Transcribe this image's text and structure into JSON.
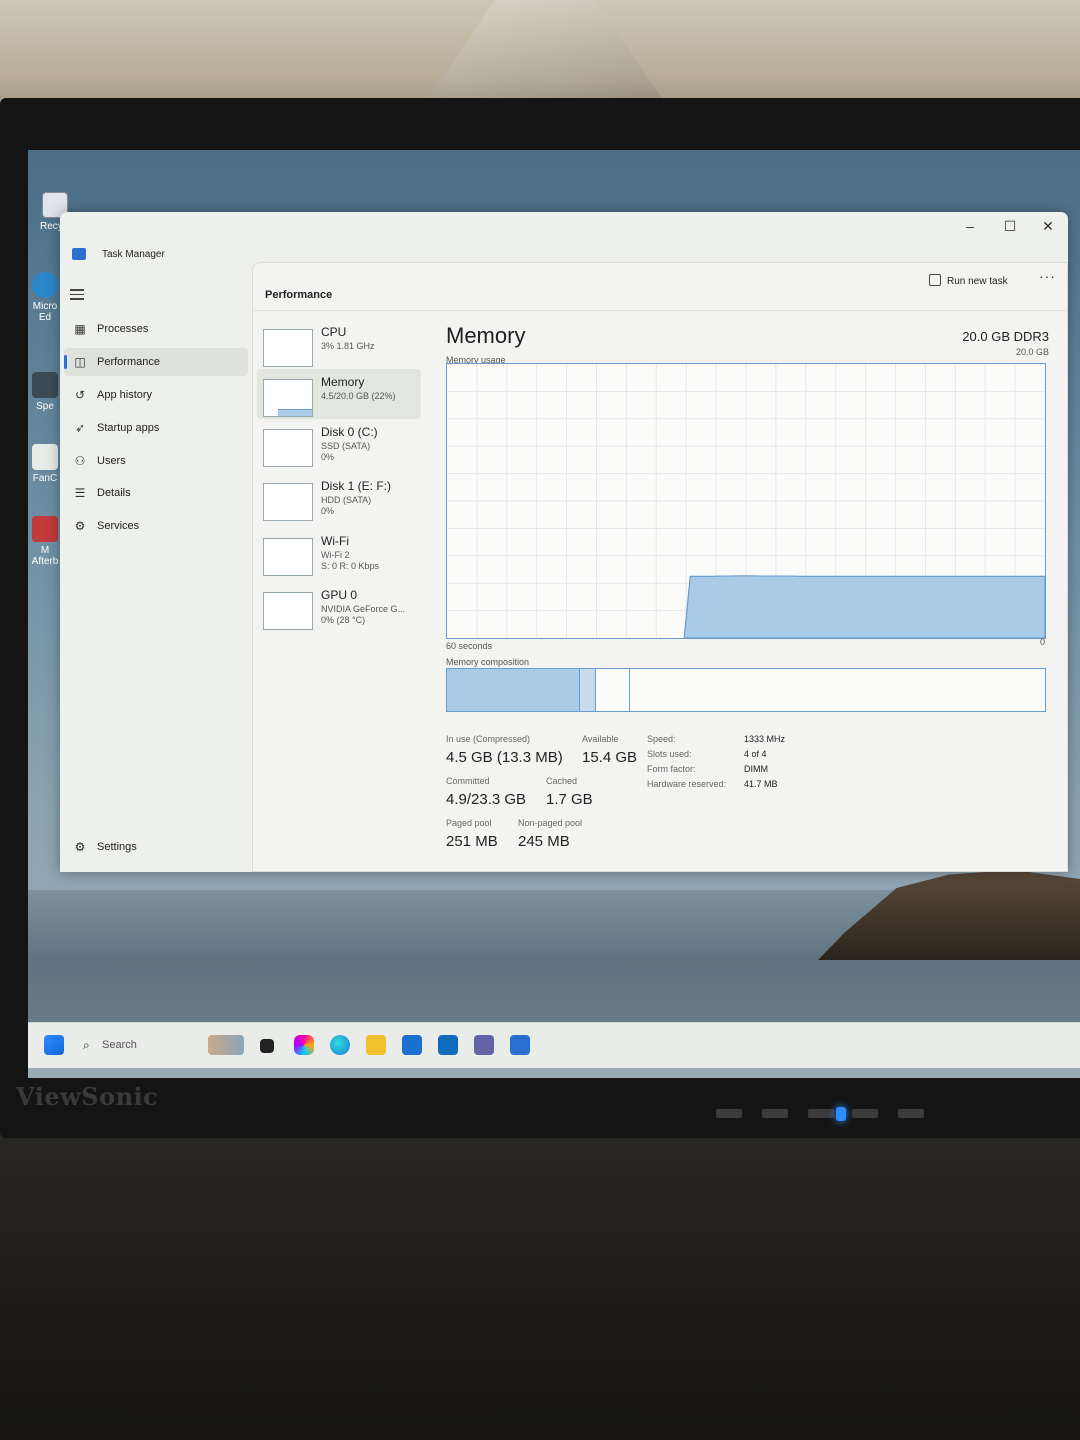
{
  "window": {
    "title": "Task Manager",
    "minimize": "–",
    "maximize": "☐",
    "close": "✕"
  },
  "header": {
    "section": "Performance",
    "run_new_task": "Run new task",
    "more": "···"
  },
  "nav": [
    {
      "label": "Processes",
      "icon": "grid-icon"
    },
    {
      "label": "Performance",
      "icon": "chart-icon",
      "active": true
    },
    {
      "label": "App history",
      "icon": "history-icon"
    },
    {
      "label": "Startup apps",
      "icon": "rocket-icon"
    },
    {
      "label": "Users",
      "icon": "users-icon"
    },
    {
      "label": "Details",
      "icon": "list-icon"
    },
    {
      "label": "Services",
      "icon": "puzzle-icon"
    }
  ],
  "settings": {
    "label": "Settings",
    "icon": "gear-icon"
  },
  "devices": [
    {
      "name": "CPU",
      "sub1": "3%  1.81 GHz",
      "sub2": "",
      "sub3": ""
    },
    {
      "name": "Memory",
      "sub1": "4.5/20.0 GB (22%)",
      "sub2": "",
      "sub3": "",
      "active": true
    },
    {
      "name": "Disk 0 (C:)",
      "sub1": "SSD (SATA)",
      "sub2": "0%",
      "sub3": ""
    },
    {
      "name": "Disk 1 (E: F:)",
      "sub1": "HDD (SATA)",
      "sub2": "0%",
      "sub3": ""
    },
    {
      "name": "Wi-Fi",
      "sub1": "Wi-Fi 2",
      "sub2": "S: 0  R: 0 Kbps",
      "sub3": ""
    },
    {
      "name": "GPU 0",
      "sub1": "NVIDIA GeForce G...",
      "sub2": "0%  (28 °C)",
      "sub3": ""
    }
  ],
  "memory": {
    "title": "Memory",
    "type": "20.0 GB DDR3",
    "usage_label": "Memory usage",
    "max_label": "20.0 GB",
    "time_label": "60 seconds",
    "zero_label": "0",
    "composition_label": "Memory composition",
    "usage_history_fraction": [
      0,
      0,
      0,
      0,
      0,
      0,
      0,
      0,
      0,
      0,
      0,
      0,
      0,
      0,
      0,
      0,
      0,
      0,
      0,
      0,
      0,
      0,
      0,
      0,
      0.225,
      0.225,
      0.225,
      0.226,
      0.226,
      0.227,
      0.227,
      0.226,
      0.226,
      0.226,
      0.226,
      0.225,
      0.225,
      0.225,
      0.225,
      0.225,
      0.225,
      0.225,
      0.225,
      0.225,
      0.225,
      0.225,
      0.225,
      0.225,
      0.225,
      0.225,
      0.225,
      0.225,
      0.225,
      0.225,
      0.225,
      0.225,
      0.225,
      0.225,
      0.225,
      0.225
    ],
    "stats": {
      "in_use_label": "In use (Compressed)",
      "in_use": "4.5 GB (13.3 MB)",
      "available_label": "Available",
      "available": "15.4 GB",
      "committed_label": "Committed",
      "committed": "4.9/23.3 GB",
      "cached_label": "Cached",
      "cached": "1.7 GB",
      "paged_label": "Paged pool",
      "paged": "251 MB",
      "nonpaged_label": "Non-paged pool",
      "nonpaged": "245 MB"
    },
    "specs": {
      "speed_label": "Speed:",
      "speed": "1333 MHz",
      "slots_label": "Slots used:",
      "slots": "4 of 4",
      "form_label": "Form factor:",
      "form": "DIMM",
      "hw_label": "Hardware reserved:",
      "hw": "41.7 MB"
    }
  },
  "taskbar": {
    "search_placeholder": "Search"
  },
  "desktop": {
    "icon1": "Recycle",
    "icon2": "Micro Ed",
    "icon3": "Spe",
    "icon4": "FanC",
    "icon5": "M Afterb"
  },
  "brand": "ViewSonic",
  "colors": {
    "accent": "#2b6fd1",
    "graph_fill": "#a9cbe8",
    "graph_line": "#6a9ccc"
  }
}
